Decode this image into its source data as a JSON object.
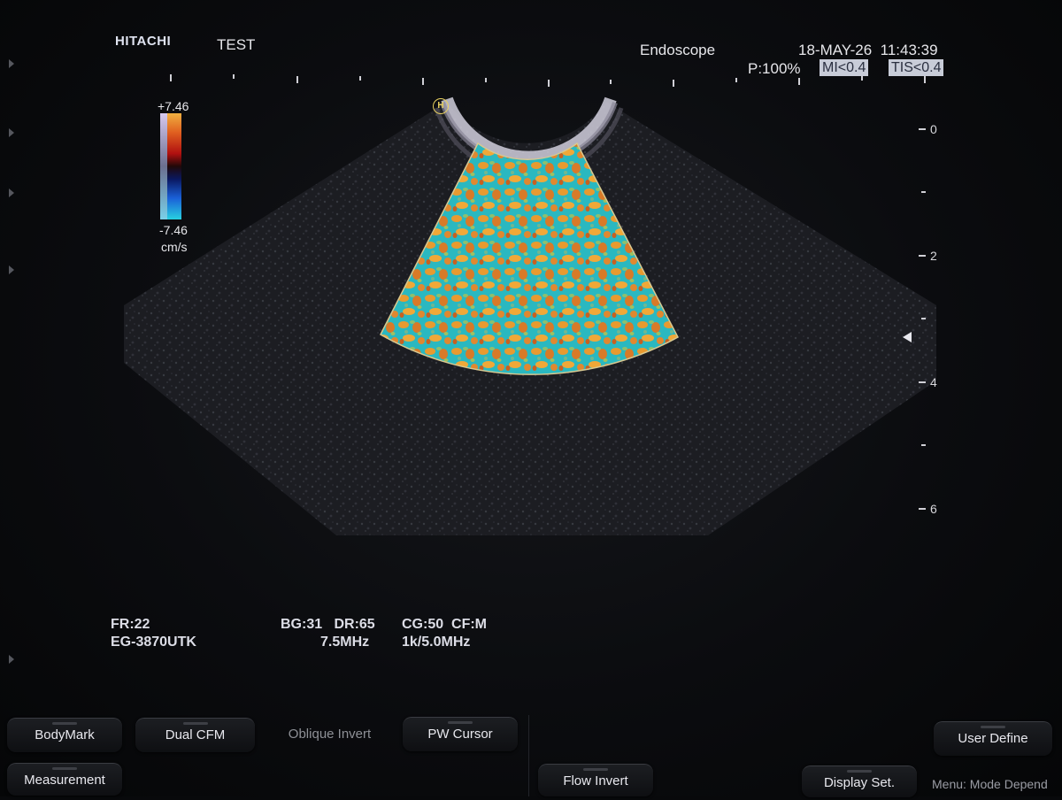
{
  "header": {
    "brand": "HITACHI",
    "patient_id": "TEST",
    "preset": "Endoscope",
    "date": "18-MAY-26",
    "time": "11:43:39",
    "power": "P:100%",
    "mi": "MI<0.4",
    "tis": "TIS<0.4"
  },
  "colorbar": {
    "max": "+7.46",
    "min": "-7.46",
    "unit": "cm/s"
  },
  "orientation_marker": "H",
  "depth_scale": [
    "0",
    "2",
    "4",
    "6"
  ],
  "params": {
    "fr": "FR:22",
    "probe": "EG-3870UTK",
    "bg_dr": "BG:31   DR:65",
    "freq_b": "7.5MHz",
    "cg_cf": "CG:50  CF:M",
    "freq_cf": "1k/5.0MHz"
  },
  "buttons": {
    "bodymark": "BodyMark",
    "dual_cfm": "Dual CFM",
    "oblique_invert": "Oblique Invert",
    "pw_cursor": "PW Cursor",
    "user_define": "User Define",
    "measurement": "Measurement",
    "flow_invert": "Flow Invert",
    "display_set": "Display Set."
  },
  "menu_hint": "Menu: Mode Depend",
  "colors": {
    "background": "#08090b",
    "badge_bg": "#c8ccd8",
    "marker_yellow": "#e8d060"
  }
}
